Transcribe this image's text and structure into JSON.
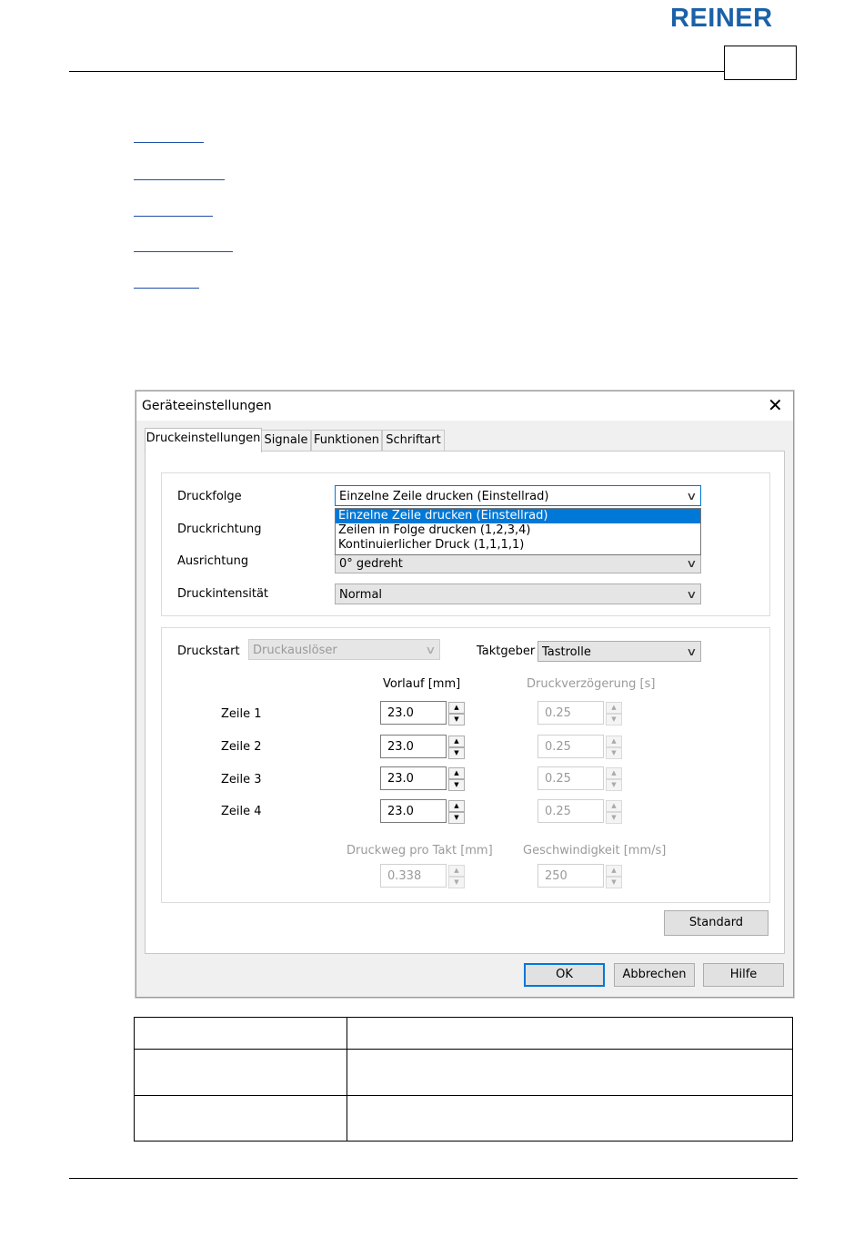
{
  "brand": {
    "logo_text": "REINER",
    "color": "#1b61a8"
  },
  "dialog": {
    "title": "Geräteeinstellungen",
    "tabs": [
      "Druckeinstellungen",
      "Signale",
      "Funktionen",
      "Schriftart"
    ],
    "print_settings": {
      "druckfolge": {
        "label": "Druckfolge",
        "value": "Einzelne Zeile drucken (Einstellrad)"
      },
      "druckfolge_options": [
        "Einzelne Zeile drucken (Einstellrad)",
        "Zeilen in Folge drucken (1,2,3,4)",
        "Kontinuierlicher Druck (1,1,1,1)"
      ],
      "druckrichtung": {
        "label": "Druckrichtung"
      },
      "ausrichtung": {
        "label": "Ausrichtung",
        "value": "0° gedreht"
      },
      "druckintensitaet": {
        "label": "Druckintensität",
        "value": "Normal"
      }
    },
    "timing": {
      "druckstart": {
        "label": "Druckstart",
        "value": "Druckauslöser"
      },
      "taktgeber": {
        "label": "Taktgeber",
        "value": "Tastrolle"
      },
      "vorlauf_header": "Vorlauf [mm]",
      "verzoegerung_header": "Druckverzögerung [s]",
      "rows": [
        {
          "label": "Zeile 1",
          "vorlauf": "23.0",
          "verzoegerung": "0.25"
        },
        {
          "label": "Zeile 2",
          "vorlauf": "23.0",
          "verzoegerung": "0.25"
        },
        {
          "label": "Zeile 3",
          "vorlauf": "23.0",
          "verzoegerung": "0.25"
        },
        {
          "label": "Zeile 4",
          "vorlauf": "23.0",
          "verzoegerung": "0.25"
        }
      ],
      "druckweg": {
        "label": "Druckweg pro Takt [mm]",
        "value": "0.338"
      },
      "geschwindigkeit": {
        "label": "Geschwindigkeit [mm/s]",
        "value": "250"
      }
    },
    "buttons": {
      "standard": "Standard",
      "ok": "OK",
      "cancel": "Abbrechen",
      "help": "Hilfe"
    }
  },
  "icons": {
    "close": "close-icon",
    "dropdown": "chevron-down-icon",
    "spin_up": "spin-up-icon",
    "spin_down": "spin-down-icon"
  }
}
